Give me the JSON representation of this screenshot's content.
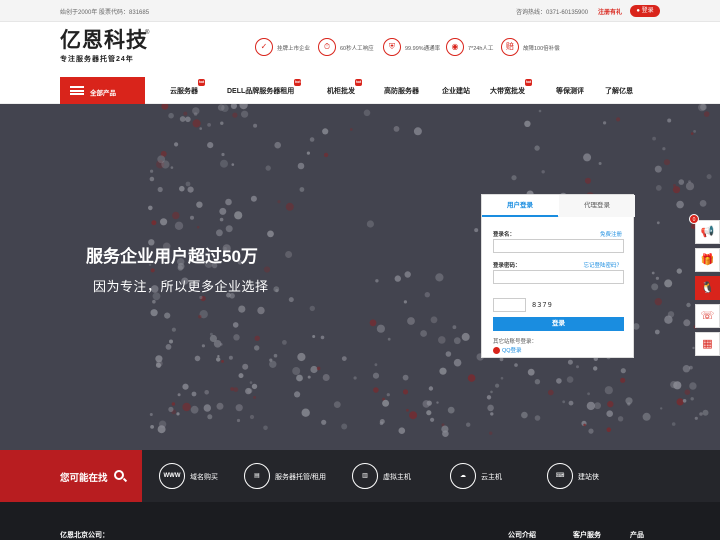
{
  "topbar": {
    "intro": "始创于2000年 股票代码：831685",
    "hotline": "咨询热线：0371-60135900",
    "register": "注册有礼",
    "login": "登录"
  },
  "header": {
    "logo_name": "亿恩科技",
    "logo_reg": "®",
    "logo_slogan": "专注服务器托管24年",
    "features": [
      {
        "icon": "shield-icon",
        "glyph": "✓",
        "label": "挂牌上市企业"
      },
      {
        "icon": "clock-icon",
        "glyph": "⏱",
        "label": "60秒人工响应"
      },
      {
        "icon": "lock-icon",
        "glyph": "⛨",
        "label": "99.99%通通率"
      },
      {
        "icon": "eye-icon",
        "glyph": "◉",
        "label": "7*24h人工"
      },
      {
        "icon": "compensation-icon",
        "glyph": "赔",
        "label": "故障100倍补偿"
      }
    ]
  },
  "nav": {
    "all_products": "全部产品",
    "items": [
      {
        "label": "云服务器",
        "hot": true
      },
      {
        "label": "DELL品牌服务器租用",
        "hot": true
      },
      {
        "label": "机柜批发",
        "hot": true
      },
      {
        "label": "高防服务器",
        "hot": false
      },
      {
        "label": "企业建站",
        "hot": false
      },
      {
        "label": "大带宽批发",
        "hot": true
      },
      {
        "label": "等保测评",
        "hot": false
      },
      {
        "label": "了解亿恩",
        "hot": false
      }
    ],
    "hot_label": "hot"
  },
  "banner": {
    "headline": "服务企业用户超过50万",
    "subline": "因为专注，所以更多企业选择"
  },
  "login": {
    "tab_user": "用户登录",
    "tab_agent": "代理登录",
    "username_label": "登录名：",
    "free_register": "免费注册",
    "password_label": "登录密码：",
    "forgot": "忘记登陆密码？",
    "captcha": "8379",
    "submit": "登录",
    "other": "其它站账号登录：",
    "qq": "QQ登录"
  },
  "float": {
    "badge": "0",
    "buttons": [
      {
        "icon": "megaphone-icon",
        "glyph": "📢"
      },
      {
        "icon": "gift-icon",
        "glyph": "🎁"
      },
      {
        "icon": "qq-icon",
        "glyph": "🐧"
      },
      {
        "icon": "phone-icon",
        "glyph": "☏"
      },
      {
        "icon": "qrcode-icon",
        "glyph": "▦"
      }
    ]
  },
  "strip": {
    "find_label": "您可能在找",
    "items": [
      {
        "icon": "www-icon",
        "glyph": "WWW",
        "label": "域名购买"
      },
      {
        "icon": "server-hosting-icon",
        "glyph": "▤",
        "label": "服务器托管/租用"
      },
      {
        "icon": "virtual-host-icon",
        "glyph": "▥",
        "label": "虚拟主机"
      },
      {
        "icon": "cloud-host-icon",
        "glyph": "☁",
        "label": "云主机"
      },
      {
        "icon": "site-builder-icon",
        "glyph": "⌨",
        "label": "建站侠"
      }
    ]
  },
  "footer": {
    "company": "亿恩北京公司：",
    "links": [
      "公司介绍",
      "客户服务",
      "产品"
    ]
  },
  "colors": {
    "brand_red": "#d9241b",
    "link_blue": "#1a8de0",
    "banner_bg": "#43444f"
  }
}
